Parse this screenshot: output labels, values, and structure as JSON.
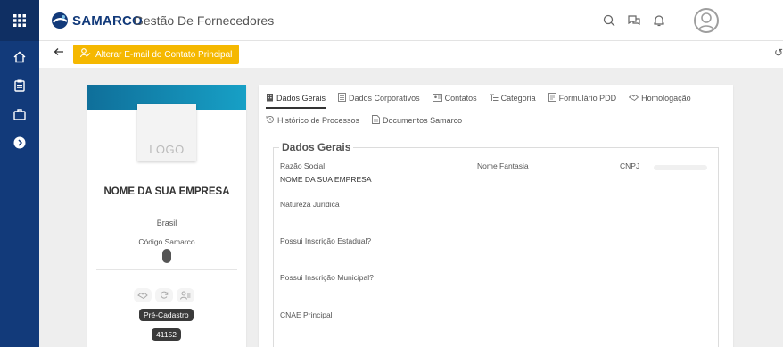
{
  "header": {
    "brand": "SAMARCO",
    "app_title": "Gestão De Fornecedores"
  },
  "icons": {
    "rail": [
      "grid-icon",
      "home-icon",
      "clipboard-icon",
      "briefcase-icon",
      "info-icon"
    ],
    "header": [
      "search-icon",
      "chat-icon",
      "bell-icon",
      "user-avatar-icon"
    ]
  },
  "toolbar": {
    "email_button": "Alterar E-mail do Contato Principal",
    "right_clip": "↺"
  },
  "profile": {
    "logo_placeholder": "LOGO",
    "company_name": "NOME DA SUA EMPRESA",
    "country": "Brasil",
    "code_label": "Código Samarco",
    "status_badge": "Pré-Cadastro",
    "id_badge": "41152"
  },
  "tabs": [
    {
      "label": "Dados Gerais",
      "active": true
    },
    {
      "label": "Dados Corporativos"
    },
    {
      "label": "Contatos"
    },
    {
      "label": "Categoria"
    },
    {
      "label": "Formulário PDD"
    },
    {
      "label": "Homologação"
    },
    {
      "label": "Histórico de Processos"
    },
    {
      "label": "Documentos Samarco"
    }
  ],
  "section": {
    "title": "Dados Gerais",
    "razao_social_label": "Razão Social",
    "razao_social_value": "NOME DA SUA EMPRESA",
    "nome_fantasia_label": "Nome Fantasia",
    "cnpj_label": "CNPJ",
    "natureza_label": "Natureza Jurídica",
    "inscricao_estadual_label": "Possui Inscrição Estadual?",
    "inscricao_municipal_label": "Possui Inscrição Municipal?",
    "cnae_label": "CNAE Principal"
  },
  "colors": {
    "rail": "#123a7a",
    "accent_button": "#f5b800",
    "card_band": "#17a0c6"
  }
}
